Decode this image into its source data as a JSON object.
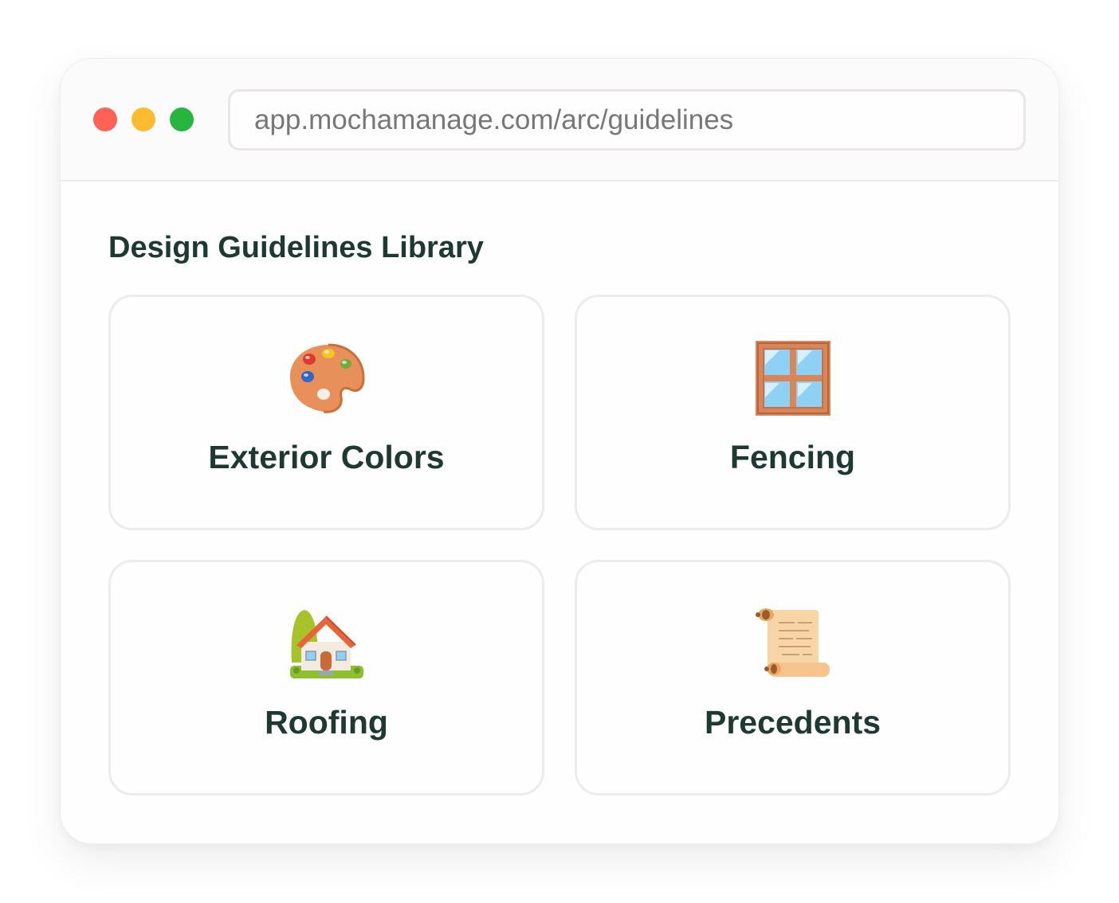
{
  "browser": {
    "url": "app.mochamanage.com/arc/guidelines"
  },
  "page": {
    "title": "Design Guidelines Library"
  },
  "cards": [
    {
      "label": "Exterior Colors",
      "icon": "artist-palette-icon"
    },
    {
      "label": "Fencing",
      "icon": "window-icon"
    },
    {
      "label": "Roofing",
      "icon": "house-with-garden-icon"
    },
    {
      "label": "Precedents",
      "icon": "scroll-icon"
    }
  ],
  "colors": {
    "text": "#1e3932",
    "traffic_red": "#fe6257",
    "traffic_yellow": "#fdbb2f",
    "traffic_green": "#27b53f",
    "url_text": "#777777",
    "card_border": "#ececec"
  }
}
